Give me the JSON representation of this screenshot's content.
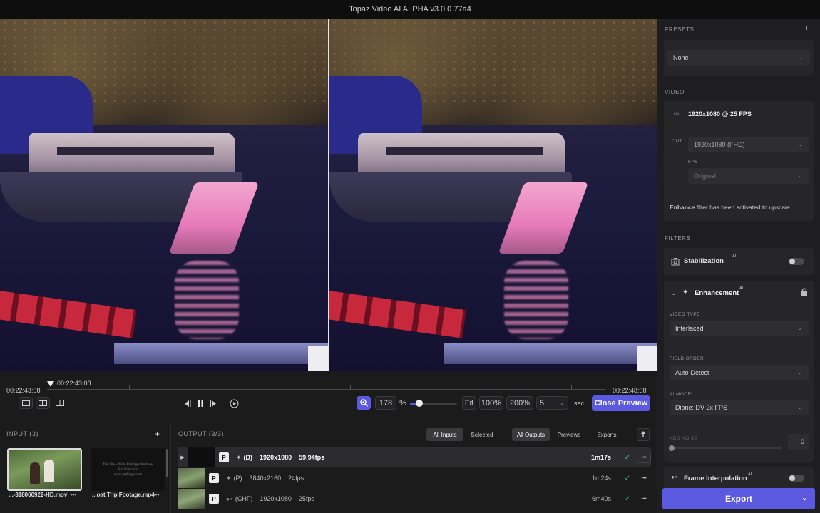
{
  "app": {
    "title": "Topaz Video AI ALPHA  v3.0.0.77a4"
  },
  "timeline": {
    "tc_start": "00:22:43;08",
    "tc_playhead": "00:22:43;08",
    "tc_end": "00:22:48;08",
    "zoom_value": "178",
    "zoom_unit": "%",
    "zoom_level": 0.2,
    "fit_label": "Fit",
    "z100_label": "100%",
    "z200_label": "200%",
    "duration_value": "5",
    "duration_unit": "sec",
    "close_preview_label": "Close Preview"
  },
  "input": {
    "header": "INPUT (3)",
    "add": "+",
    "files": [
      {
        "name": "...-318060922-HD.mov",
        "more": "•••"
      },
      {
        "name": "...oat Trip Footage.mp4",
        "more": "•••"
      }
    ],
    "thumb2_lines": [
      "This file is from Prelinger Archives",
      "San Francisco",
      "www.prelinger.com"
    ]
  },
  "output": {
    "header": "OUTPUT (3/3)",
    "filters": {
      "inputs": [
        "All Inputs",
        "Selected"
      ],
      "outputs": [
        "All Outputs",
        "Previews",
        "Exports"
      ]
    },
    "rows": [
      {
        "badge": "P",
        "model": "(D)",
        "res": "1920x1080",
        "fps": "59.94fps",
        "time": "1m17s",
        "check": "✓",
        "more": "•••"
      },
      {
        "badge": "P",
        "model": "(P)",
        "res": "3840x2160",
        "fps": "24fps",
        "time": "1m24s",
        "check": "✓",
        "more": "•••"
      },
      {
        "badge": "P",
        "model": "(CHF)",
        "res": "1920x1080",
        "fps": "25fps",
        "time": "6m40s",
        "check": "✓",
        "more": "•••"
      }
    ]
  },
  "sidebar": {
    "presets": {
      "header": "PRESETS",
      "add": "+",
      "value": "None"
    },
    "video": {
      "header": "VIDEO",
      "in_label": "IN",
      "in_value": "1920x1080 @ 25 FPS",
      "out_label": "OUT",
      "out_value": "1920x1080 (FHD)",
      "fps_label": "FPS",
      "fps_value": "Original",
      "note_bold": "Enhance",
      "note_rest": " filter has been activated to upscale."
    },
    "filters": {
      "header": "FILTERS",
      "stabilization": "Stabilization",
      "ai_tag": "AI",
      "enhancement": "Enhancement",
      "video_type_label": "VIDEO TYPE",
      "video_type_value": "Interlaced",
      "field_order_label": "FIELD ORDER",
      "field_order_value": "Auto-Detect",
      "ai_model_label": "AI MODEL",
      "ai_model_value": "Dione: DV 2x FPS",
      "add_noise_label": "ADD NOISE",
      "add_noise_value": "0",
      "frame_interp": "Frame Interpolation"
    },
    "export_label": "Export"
  },
  "colors": {
    "accent": "#5a59e0",
    "success": "#2ec27e"
  }
}
